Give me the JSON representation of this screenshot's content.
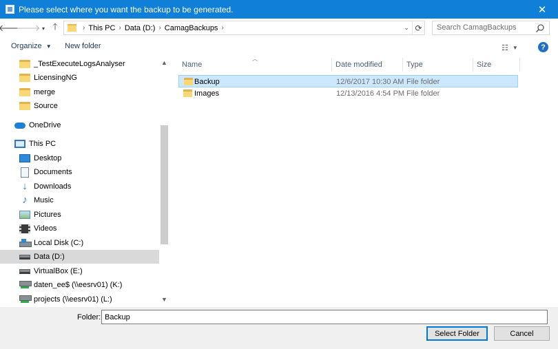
{
  "window": {
    "title": "Please select where you want the backup to be generated.",
    "close_glyph": "✕"
  },
  "address": {
    "crumbs": [
      "This PC",
      "Data (D:)",
      "CamagBackups"
    ]
  },
  "search": {
    "placeholder": "Search CamagBackups"
  },
  "toolbar": {
    "organize": "Organize",
    "new_folder": "New folder",
    "help": "?"
  },
  "navpane": {
    "items": [
      {
        "label": "_TestExecuteLogsAnalyser",
        "icon": "folder-icon"
      },
      {
        "label": "LicensingNG",
        "icon": "folder-icon"
      },
      {
        "label": "merge",
        "icon": "folder-icon"
      },
      {
        "label": "Source",
        "icon": "folder-icon"
      },
      {
        "label": "OneDrive",
        "icon": "onedrive-icon"
      },
      {
        "label": "This PC",
        "icon": "this-pc-icon"
      },
      {
        "label": "Desktop",
        "icon": "desktop-icon"
      },
      {
        "label": "Documents",
        "icon": "documents-icon"
      },
      {
        "label": "Downloads",
        "icon": "downloads-icon"
      },
      {
        "label": "Music",
        "icon": "music-icon"
      },
      {
        "label": "Pictures",
        "icon": "pictures-icon"
      },
      {
        "label": "Videos",
        "icon": "videos-icon"
      },
      {
        "label": "Local Disk (C:)",
        "icon": "local-disk-icon"
      },
      {
        "label": "Data (D:)",
        "icon": "drive-icon",
        "selected": true
      },
      {
        "label": "VirtualBox (E:)",
        "icon": "drive-icon"
      },
      {
        "label": "daten_ee$ (\\\\eesrv01) (K:)",
        "icon": "network-drive-icon"
      },
      {
        "label": "projects (\\\\eesrv01) (L:)",
        "icon": "network-drive-icon"
      }
    ]
  },
  "filelist": {
    "columns": [
      "Name",
      "Date modified",
      "Type",
      "Size"
    ],
    "rows": [
      {
        "name": "Backup",
        "date": "12/6/2017 10:30 AM",
        "type": "File folder",
        "size": "",
        "selected": true
      },
      {
        "name": "Images",
        "date": "12/13/2016 4:54 PM",
        "type": "File folder",
        "size": ""
      }
    ]
  },
  "footer": {
    "folder_label": "Folder:",
    "folder_value": "Backup",
    "select_button": "Select Folder",
    "cancel_button": "Cancel"
  }
}
